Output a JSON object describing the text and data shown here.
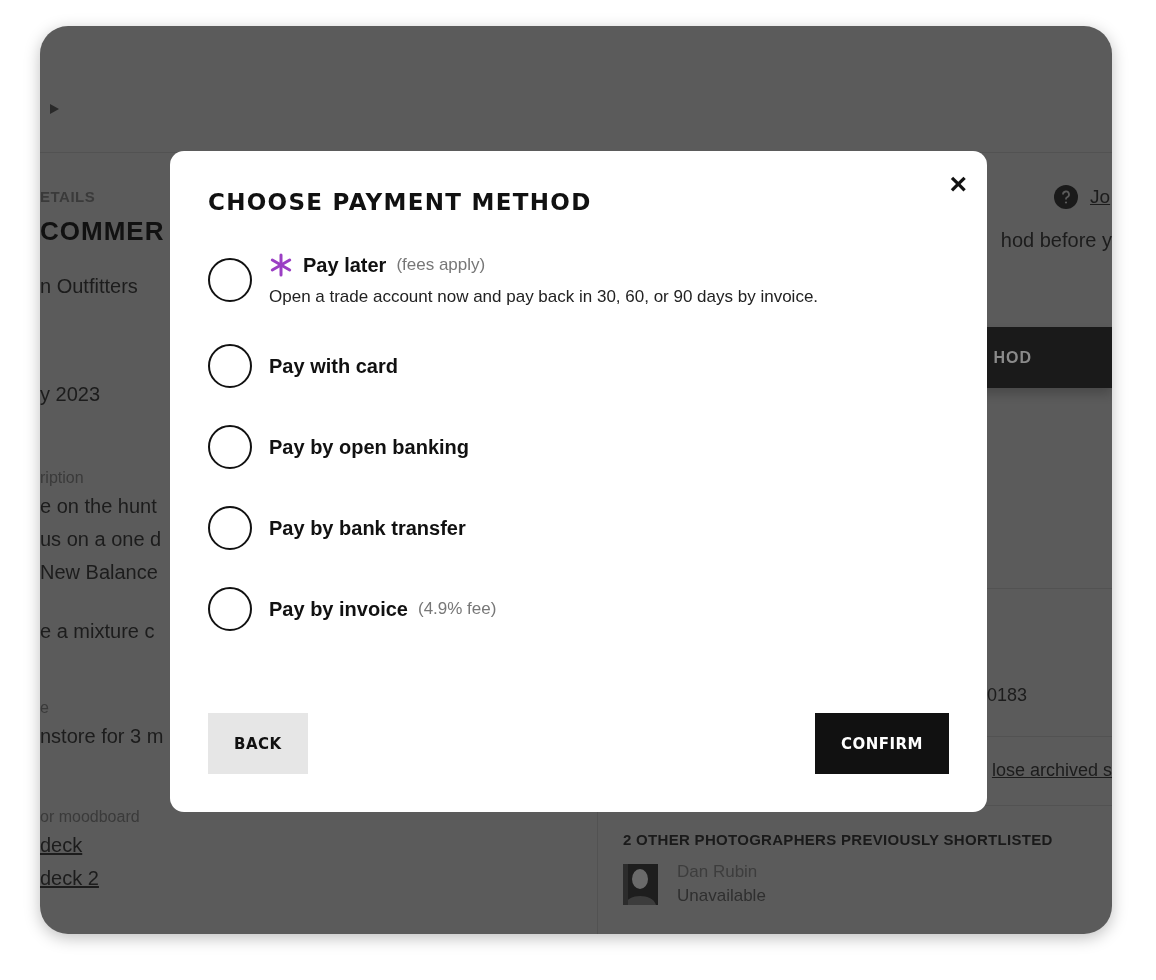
{
  "background": {
    "left_sections": [
      {
        "items": [
          {
            "kind": "label",
            "text": "ETAILS"
          },
          {
            "kind": "title",
            "text": "COMMER"
          }
        ]
      },
      {
        "items": [
          {
            "kind": "text",
            "text": "n Outfitters"
          }
        ]
      },
      {
        "items": [
          {
            "kind": "text",
            "text": "y 2023"
          }
        ]
      },
      {
        "items": [
          {
            "kind": "label",
            "text": "ription"
          },
          {
            "kind": "text",
            "text": "e on the hunt"
          },
          {
            "kind": "text",
            "text": "us on a one d"
          },
          {
            "kind": "text",
            "text": "New Balance"
          },
          {
            "kind": "break",
            "text": "e a mixture c"
          }
        ]
      },
      {
        "items": [
          {
            "kind": "label",
            "text": "e"
          },
          {
            "kind": "text",
            "text": "nstore for 3 m"
          }
        ]
      },
      {
        "items": [
          {
            "kind": "label",
            "text": "or moodboard"
          },
          {
            "kind": "link",
            "text": "deck"
          },
          {
            "kind": "link",
            "text": "deck 2"
          }
        ]
      }
    ],
    "right": {
      "help_link": "Jo",
      "notice": "hod before y",
      "dark_button": "HOD",
      "reference": "0183",
      "archive_link": "lose archived s",
      "shortlist": {
        "heading": "2 OTHER PHOTOGRAPHERS PREVIOUSLY SHORTLISTED",
        "people": [
          {
            "name": "Dan Rubin",
            "status": "Unavailable"
          }
        ]
      }
    }
  },
  "modal": {
    "title": "CHOOSE PAYMENT METHOD",
    "close": "×",
    "options": [
      {
        "label": "Pay later",
        "note": "(fees apply)",
        "description": "Open a trade account now and pay back in 30, 60, or 90 days by invoice.",
        "featured": true,
        "selected": false
      },
      {
        "label": "Pay with card",
        "selected": false
      },
      {
        "label": "Pay by open banking",
        "selected": false
      },
      {
        "label": "Pay by bank transfer",
        "selected": false
      },
      {
        "label": "Pay by invoice",
        "note": "(4.9% fee)",
        "selected": false
      }
    ],
    "buttons": [
      {
        "kind": "secondary",
        "label": "BACK"
      },
      {
        "kind": "primary",
        "label": "CONFIRM"
      }
    ]
  }
}
